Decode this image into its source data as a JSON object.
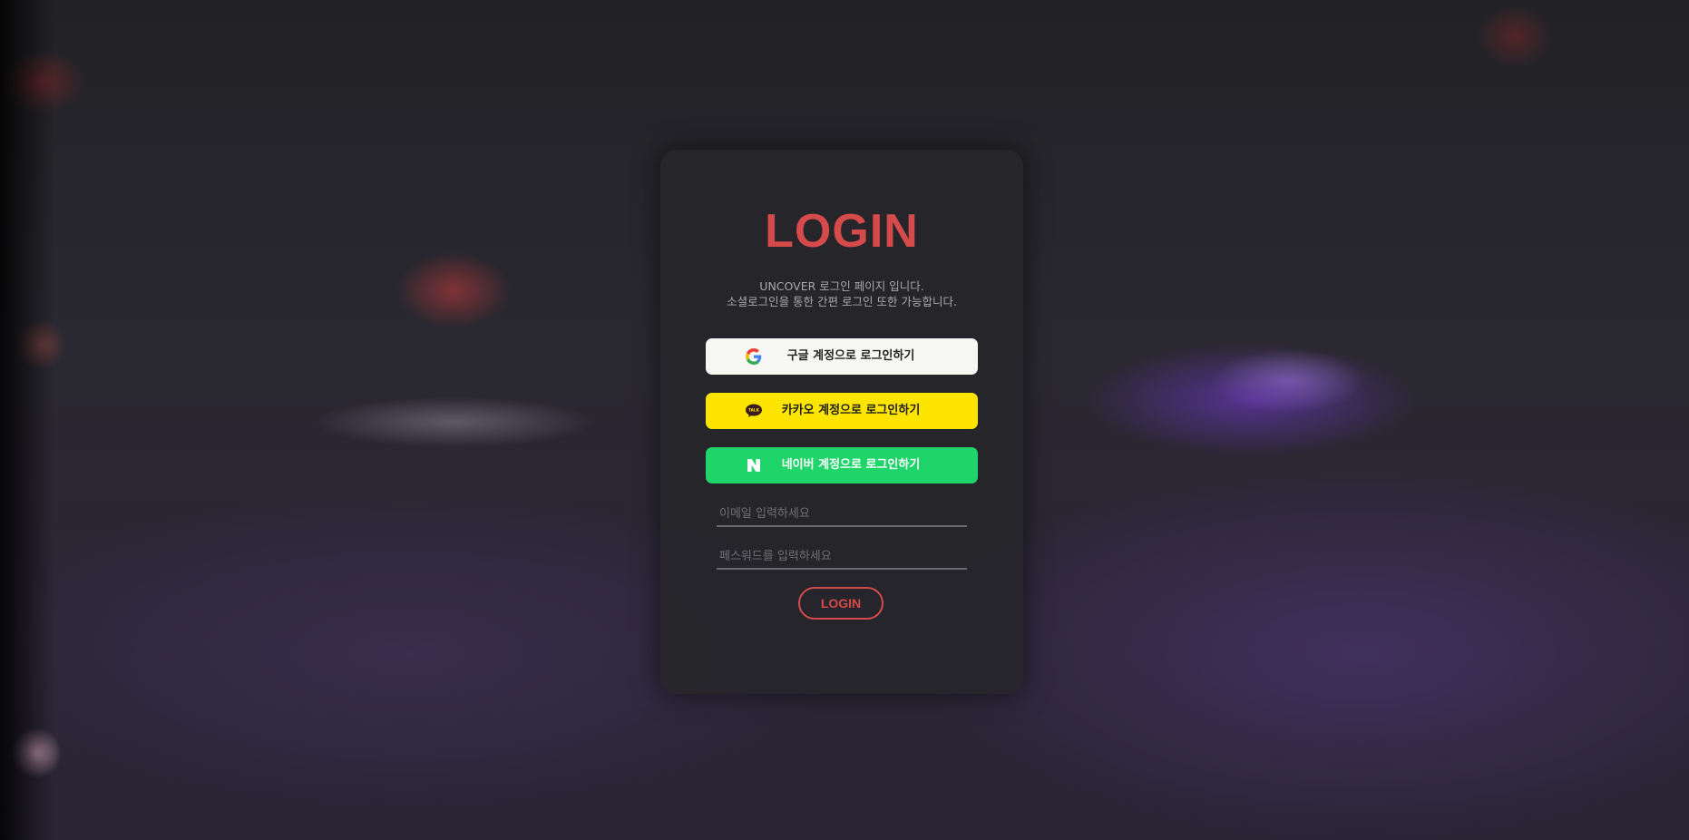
{
  "login": {
    "title": "LOGIN",
    "description_line1": "UNCOVER 로그인 페이지 입니다.",
    "description_line2": "소셜로그인을 통한 간편 로그인 또한 가능합니다.",
    "social_buttons": [
      {
        "label": "구글 계정으로 로그인하기",
        "icon": "google-icon",
        "color": "#f6f6f3"
      },
      {
        "label": "카카오 계정으로 로그인하기",
        "icon": "kakao-talk-icon",
        "color": "#fee500"
      },
      {
        "label": "네이버 계정으로 로그인하기",
        "icon": "naver-icon",
        "color": "#1fd56a"
      }
    ],
    "email_placeholder": "이메일 입력하세요",
    "password_placeholder": "페스워드를 입력하세요",
    "submit_label": "LOGIN",
    "accent_color": "#d54a4a"
  }
}
